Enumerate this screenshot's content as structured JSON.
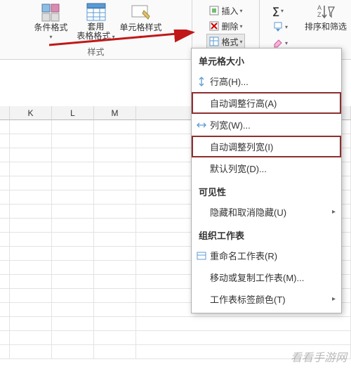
{
  "ribbon": {
    "conditional_formatting": "条件格式",
    "format_as_table_line1": "套用",
    "format_as_table_line2": "表格格式",
    "cell_styles": "单元格样式",
    "insert": "插入",
    "delete": "删除",
    "format": "格式",
    "sort_filter": "排序和筛选",
    "group_styles": "样式"
  },
  "columns": [
    "K",
    "L",
    "M"
  ],
  "menu": {
    "section_cell_size": "单元格大小",
    "row_height": "行高(H)...",
    "autofit_row_height": "自动调整行高(A)",
    "column_width": "列宽(W)...",
    "autofit_column_width": "自动调整列宽(I)",
    "default_width": "默认列宽(D)...",
    "section_visibility": "可见性",
    "hide_unhide": "隐藏和取消隐藏(U)",
    "section_organize": "组织工作表",
    "rename_sheet": "重命名工作表(R)",
    "move_copy_sheet": "移动或复制工作表(M)...",
    "tab_color": "工作表标签颜色(T)"
  },
  "watermark": "看看手游网"
}
